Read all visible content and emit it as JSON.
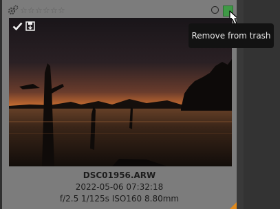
{
  "thumbnail": {
    "rating_stars": [
      "☆",
      "☆",
      "☆",
      "☆",
      "☆",
      "☆"
    ],
    "filename": "DSC01956.ARW",
    "datetime": "2022-05-06 07:32:18",
    "exif": "f/2.5 1/125s ISO160 8.80mm",
    "icons": {
      "group": "gear-group-icon",
      "reject": "circle-icon",
      "trash": "trash-icon",
      "selected": "check-icon",
      "local_copy": "save-icon"
    },
    "colors": {
      "card_bg": "#7c7c7c",
      "trash_green": "#3f9a46",
      "corner_accent": "#e08a1e"
    }
  },
  "tooltip": {
    "text": "Remove from trash"
  }
}
